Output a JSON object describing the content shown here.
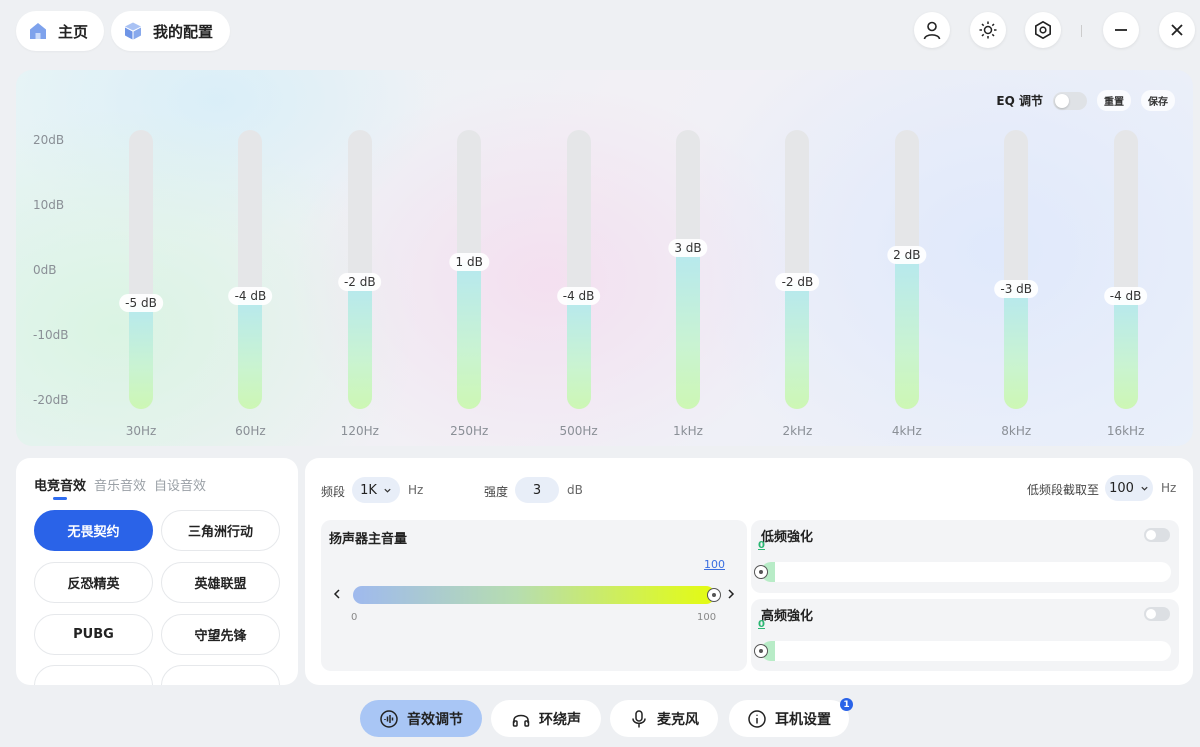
{
  "topbar": {
    "home_label": "主页",
    "config_label": "我的配置"
  },
  "eq": {
    "toggle_label": "EQ 调节",
    "reset_label": "重置",
    "save_label": "保存",
    "db_range": [
      -20,
      20
    ],
    "y_labels": [
      "20dB",
      "10dB",
      "0dB",
      "-10dB",
      "-20dB"
    ],
    "bands": [
      {
        "freq": "30Hz",
        "value": -5,
        "value_label": "-5 dB"
      },
      {
        "freq": "60Hz",
        "value": -4,
        "value_label": "-4 dB"
      },
      {
        "freq": "120Hz",
        "value": -2,
        "value_label": "-2 dB"
      },
      {
        "freq": "250Hz",
        "value": 1,
        "value_label": "1 dB"
      },
      {
        "freq": "500Hz",
        "value": -4,
        "value_label": "-4 dB"
      },
      {
        "freq": "1kHz",
        "value": 3,
        "value_label": "3 dB"
      },
      {
        "freq": "2kHz",
        "value": -2,
        "value_label": "-2 dB"
      },
      {
        "freq": "4kHz",
        "value": 2,
        "value_label": "2 dB"
      },
      {
        "freq": "8kHz",
        "value": -3,
        "value_label": "-3 dB"
      },
      {
        "freq": "16kHz",
        "value": -4,
        "value_label": "-4 dB"
      }
    ]
  },
  "presets": {
    "tabs": [
      "电竞音效",
      "音乐音效",
      "自设音效"
    ],
    "active_tab": 0,
    "items": [
      "无畏契约",
      "三角洲行动",
      "反恐精英",
      "英雄联盟",
      "PUBG",
      "守望先锋"
    ],
    "active_item": 0
  },
  "settings": {
    "band_label": "频段",
    "band_value": "1K",
    "band_unit": "Hz",
    "strength_label": "强度",
    "strength_value": "3",
    "strength_unit": "dB",
    "lowcut_label": "低频段截取至",
    "lowcut_value": "100",
    "lowcut_unit": "Hz",
    "speaker_title": "扬声器主音量",
    "volume": 100,
    "volume_label": "100",
    "vol_min": "0",
    "vol_max": "100",
    "bass_title": "低频強化",
    "bass_value": "0",
    "treble_title": "高频強化",
    "treble_value": "0"
  },
  "bottom_tabs": [
    {
      "label": "音效调节",
      "icon": "sound-wave-icon"
    },
    {
      "label": "环绕声",
      "icon": "headphones-icon"
    },
    {
      "label": "麦克风",
      "icon": "microphone-icon"
    },
    {
      "label": "耳机设置",
      "icon": "info-icon"
    }
  ],
  "badge_count": "1",
  "colors": {
    "accent": "#2a63e8",
    "active_tab": "#a9c6f5",
    "eq_fill_top": "#b6e8ef",
    "eq_fill_bottom": "#cdf7b4"
  }
}
